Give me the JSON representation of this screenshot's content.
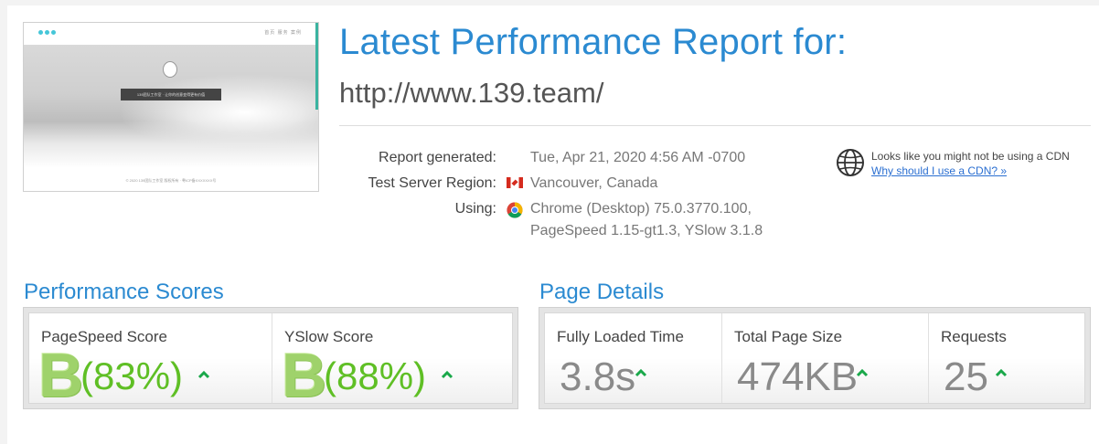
{
  "thumbnail": {
    "banner_text": "139团队工作室 · 让你的创意变得更有价值",
    "footer_text": "© 2020 139团队工作室 版权所有 · 粤ICP备XXXXXXX号",
    "nav_text": "首页  服务  案例"
  },
  "header": {
    "title": "Latest Performance Report for:",
    "url": "http://www.139.team/"
  },
  "report": {
    "generated_label": "Report generated:",
    "generated_value": "Tue, Apr 21, 2020 4:56 AM -0700",
    "region_label": "Test Server Region:",
    "region_value": "Vancouver, Canada",
    "using_label": "Using:",
    "using_line1": "Chrome (Desktop) 75.0.3770.100,",
    "using_line2": "PageSpeed 1.15-gt1.3, YSlow 3.1.8"
  },
  "cdn": {
    "text": "Looks like you might not be using a CDN",
    "link": "Why should I use a CDN? »",
    "icon": "globe-icon"
  },
  "performance": {
    "title": "Performance Scores",
    "scores": [
      {
        "label": "PageSpeed Score",
        "grade": "B",
        "percent": "(83%)"
      },
      {
        "label": "YSlow Score",
        "grade": "B",
        "percent": "(88%)"
      }
    ]
  },
  "details": {
    "title": "Page Details",
    "items": [
      {
        "label": "Fully Loaded Time",
        "value": "3.8s"
      },
      {
        "label": "Total Page Size",
        "value": "474KB"
      },
      {
        "label": "Requests",
        "value": "25"
      }
    ]
  },
  "colors": {
    "accent_blue": "#2b8ad1",
    "grade_green": "#9fd26b",
    "percent_green": "#5fbf25",
    "arrow_green": "#1aa84a"
  }
}
